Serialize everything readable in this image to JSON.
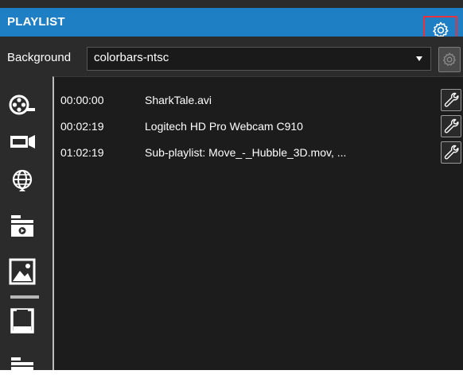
{
  "header": {
    "title": "PLAYLIST",
    "settings_icon": "gear-icon"
  },
  "background": {
    "label": "Background",
    "selected": "colorbars-ntsc",
    "settings_icon": "gear-icon"
  },
  "sidebar": {
    "items": [
      {
        "icon": "film-reel-icon"
      },
      {
        "icon": "webcam-icon"
      },
      {
        "icon": "globe-icon"
      },
      {
        "icon": "folder-media-icon"
      },
      {
        "icon": "image-icon",
        "selected": true
      },
      {
        "icon": "save-icon"
      },
      {
        "icon": "folder-icon"
      }
    ]
  },
  "playlist": {
    "items": [
      {
        "time": "00:00:00",
        "name": "SharkTale.avi"
      },
      {
        "time": "00:02:19",
        "name": "Logitech HD Pro Webcam C910"
      },
      {
        "time": "01:02:19",
        "name": "Sub-playlist: Move_-_Hubble_3D.mov, ..."
      }
    ]
  },
  "colors": {
    "header_blue": "#1e7fc4",
    "highlight_red": "#e8313a",
    "panel_bg": "#2b2b2b",
    "list_bg": "#1c1c1c"
  }
}
